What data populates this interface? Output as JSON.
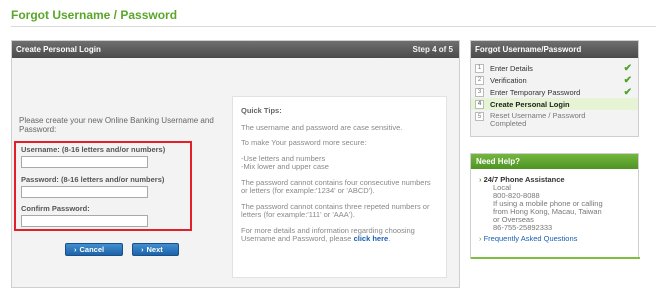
{
  "page": {
    "title": "Forgot Username / Password"
  },
  "main": {
    "header": "Create Personal Login",
    "step": "Step 4 of 5",
    "intro": "Please create your new Online Banking Username and Password:",
    "fields": [
      {
        "label": "Username: (8-16 letters and/or numbers)",
        "value": ""
      },
      {
        "label": "Password: (8-16 letters and/or numbers)",
        "value": ""
      },
      {
        "label": "Confirm Password:",
        "value": ""
      }
    ],
    "cancel_label": "Cancel",
    "next_label": "Next",
    "button_icon": "›"
  },
  "tips": {
    "title": "Quick Tips:",
    "p1": "The username and password are case sensitive.",
    "p2": "To make Your password more secure:",
    "p3a": "-Use letters and numbers",
    "p3b": "-Mix lower and upper case",
    "p4": "The password cannot contains four consecutive numbers or letters (for example:'1234' or 'ABCD').",
    "p5": "The password cannot contains three repeted numbers or letters (for example:'111' or 'AAA').",
    "p6": "For more details and information regarding choosing Username and Password, please",
    "link": "click here",
    "p6_end": "."
  },
  "sidebar": {
    "progress_title": "Forgot Username/Password",
    "steps": [
      {
        "num": "1",
        "label": "Enter Details",
        "status": "done"
      },
      {
        "num": "2",
        "label": "Verification",
        "status": "done"
      },
      {
        "num": "3",
        "label": "Enter Temporary Password",
        "status": "done"
      },
      {
        "num": "4",
        "label": "Create Personal Login",
        "status": "current"
      },
      {
        "num": "5",
        "label": "Reset Username / Password Completed",
        "status": "pending"
      }
    ],
    "check_mark": "✔",
    "help_title": "Need Help?",
    "help_item": "24/7 Phone Assistance",
    "help_lines": [
      "Local",
      "800-820-8088",
      "If using a mobile phone or calling",
      "from Hong Kong, Macau, Taiwan",
      "or Overseas",
      "86-755-25892333"
    ],
    "faq": "Frequently Asked Questions"
  },
  "colors": {
    "brand_green": "#5aa62a",
    "error_red": "#e3202a",
    "button_blue": "#1e62a8"
  }
}
